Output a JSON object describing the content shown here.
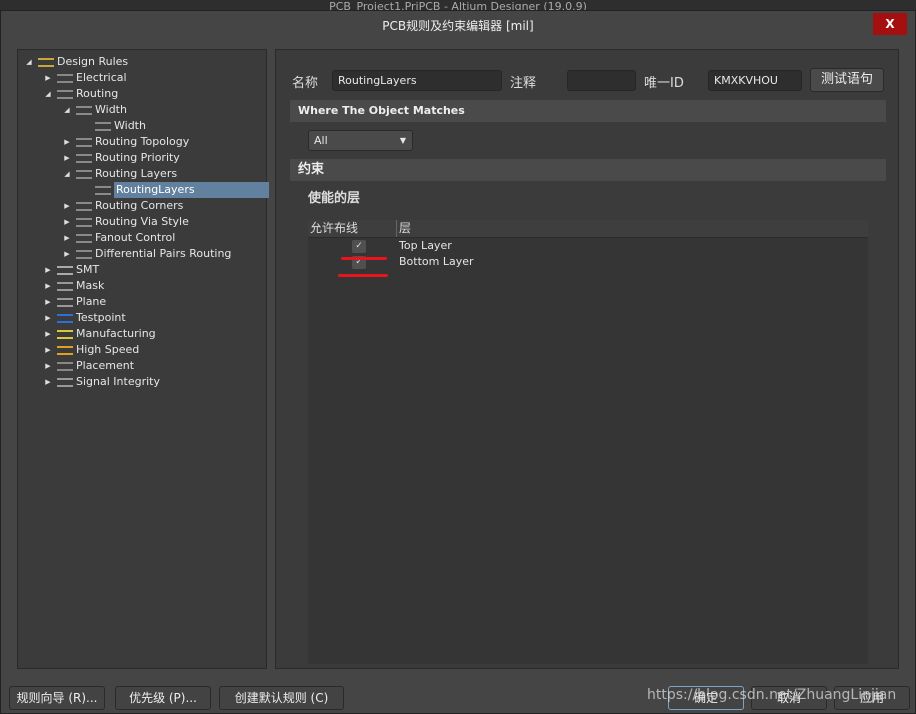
{
  "app_title": "PCB_Project1.PrjPCB - Altium Designer (19.0.9)",
  "dialog": {
    "title": "PCB规则及约束编辑器 [mil]",
    "close": "X"
  },
  "tree": [
    {
      "label": "Design Rules",
      "level": 0,
      "arrow": "expanded",
      "icon": "design-rules-folder-icon"
    },
    {
      "label": "Electrical",
      "level": 1,
      "arrow": "collapsed",
      "icon": "electrical-icon"
    },
    {
      "label": "Routing",
      "level": 1,
      "arrow": "expanded",
      "icon": "routing-icon"
    },
    {
      "label": "Width",
      "level": 2,
      "arrow": "expanded",
      "icon": "routing-icon"
    },
    {
      "label": "Width",
      "level": 3,
      "arrow": "none",
      "icon": "routing-icon"
    },
    {
      "label": "Routing Topology",
      "level": 2,
      "arrow": "collapsed",
      "icon": "routing-icon"
    },
    {
      "label": "Routing Priority",
      "level": 2,
      "arrow": "collapsed",
      "icon": "routing-icon"
    },
    {
      "label": "Routing Layers",
      "level": 2,
      "arrow": "expanded",
      "icon": "routing-icon"
    },
    {
      "label": "RoutingLayers",
      "level": 3,
      "arrow": "none",
      "icon": "routing-icon",
      "selected": true
    },
    {
      "label": "Routing Corners",
      "level": 2,
      "arrow": "collapsed",
      "icon": "routing-icon"
    },
    {
      "label": "Routing Via Style",
      "level": 2,
      "arrow": "collapsed",
      "icon": "routing-icon"
    },
    {
      "label": "Fanout Control",
      "level": 2,
      "arrow": "collapsed",
      "icon": "routing-icon"
    },
    {
      "label": "Differential Pairs Routing",
      "level": 2,
      "arrow": "collapsed",
      "icon": "routing-icon"
    },
    {
      "label": "SMT",
      "level": 1,
      "arrow": "collapsed",
      "icon": "smt-icon"
    },
    {
      "label": "Mask",
      "level": 1,
      "arrow": "collapsed",
      "icon": "mask-icon"
    },
    {
      "label": "Plane",
      "level": 1,
      "arrow": "collapsed",
      "icon": "plane-icon"
    },
    {
      "label": "Testpoint",
      "level": 1,
      "arrow": "collapsed",
      "icon": "testpoint-icon"
    },
    {
      "label": "Manufacturing",
      "level": 1,
      "arrow": "collapsed",
      "icon": "manufacturing-icon"
    },
    {
      "label": "High Speed",
      "level": 1,
      "arrow": "collapsed",
      "icon": "high-speed-icon"
    },
    {
      "label": "Placement",
      "level": 1,
      "arrow": "collapsed",
      "icon": "placement-icon"
    },
    {
      "label": "Signal Integrity",
      "level": 1,
      "arrow": "collapsed",
      "icon": "signal-integrity-icon"
    }
  ],
  "rule": {
    "name_label": "名称",
    "name_value": "RoutingLayers",
    "comment_label": "注释",
    "comment_value": "",
    "uid_label": "唯一ID",
    "uid_value": "KMXKVHOU",
    "test_button": "测试语句",
    "where_header": "Where The Object Matches",
    "scope_select": "All",
    "constraints_header": "约束",
    "enabled_layers_title": "使能的层",
    "columns": [
      "允许布线",
      "层"
    ],
    "layers": [
      {
        "name": "Top Layer",
        "allowed": true
      },
      {
        "name": "Bottom Layer",
        "allowed": true
      }
    ]
  },
  "footer": {
    "wizard": "规则向导 (R)...",
    "priority": "优先级 (P)...",
    "create_default": "创建默认规则 (C)",
    "ok": "确定",
    "cancel": "取消",
    "apply": "应用"
  },
  "watermark": "https://blog.csdn.net/ZhuangLinjian",
  "colors": {
    "selection": "#62819f",
    "close": "#a50f0f",
    "annotation": "#e8141e"
  }
}
